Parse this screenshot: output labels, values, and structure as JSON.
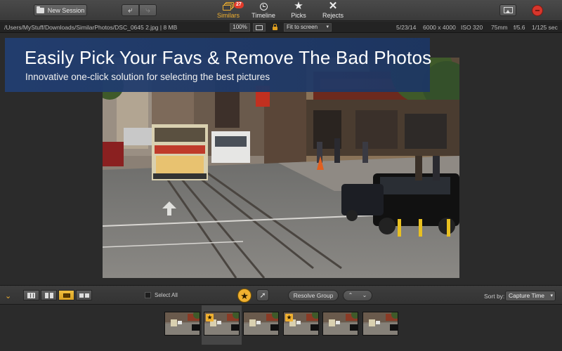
{
  "toolbar": {
    "new_session_label": "New Session",
    "modes": [
      {
        "label": "Similars",
        "badge": "27",
        "active": true
      },
      {
        "label": "Timeline"
      },
      {
        "label": "Picks"
      },
      {
        "label": "Rejects"
      }
    ],
    "accent_color": "#f0b030"
  },
  "infobar": {
    "path": "/Users/MyStuff/Downloads/SimilarPhotos/DSC_0645 2.jpg | 8 MB",
    "zoom": "100%",
    "fit_option": "Fit to screen",
    "date": "5/23/14",
    "dimensions": "6000 x 4000",
    "iso": "ISO 320",
    "focal_length": "75mm",
    "aperture": "f/5.6",
    "shutter": "1/125 sec"
  },
  "banner": {
    "headline": "Easily Pick Your Favs & Remove The Bad Photos",
    "subline": "Innovative one-click solution for selecting the best pictures"
  },
  "bottombar": {
    "select_all_label": "Select All",
    "resolve_label": "Resolve Group",
    "sort_label": "Sort by:",
    "sort_value": "Capture Time"
  },
  "filmstrip": {
    "thumbnails": [
      {
        "starred": false,
        "selected": false
      },
      {
        "starred": true,
        "selected": true
      },
      {
        "starred": false,
        "selected": false
      },
      {
        "starred": true,
        "selected": false
      },
      {
        "starred": false,
        "selected": false
      },
      {
        "starred": false,
        "selected": false
      }
    ]
  }
}
